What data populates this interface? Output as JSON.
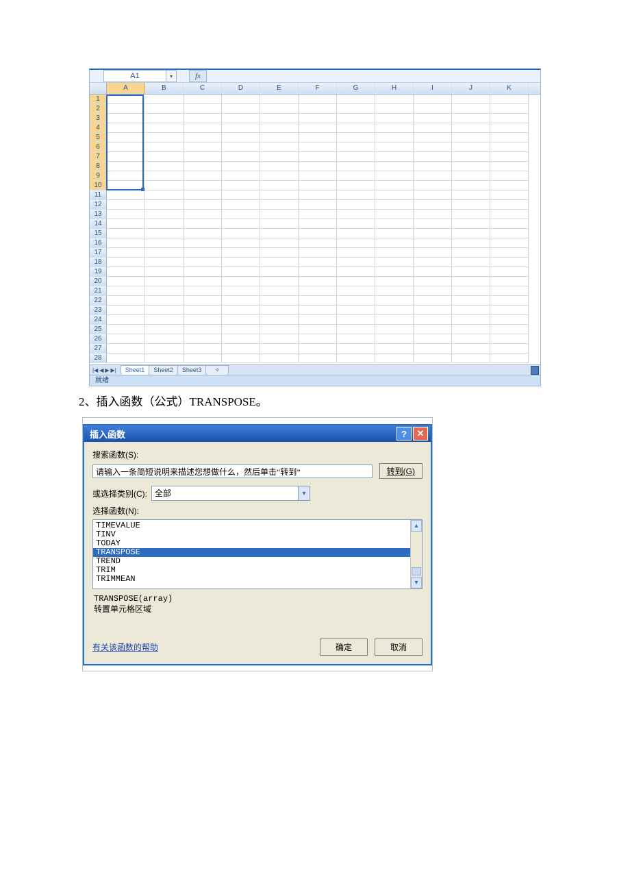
{
  "excel": {
    "namebox": "A1",
    "fx_label": "fx",
    "columns": [
      "A",
      "B",
      "C",
      "D",
      "E",
      "F",
      "G",
      "H",
      "I",
      "J",
      "K"
    ],
    "row_count": 28,
    "selected_col_index": 0,
    "selected_rows_end": 10,
    "sheet_nav": [
      "|◀",
      "◀",
      "▶",
      "▶|"
    ],
    "tabs": [
      "Sheet1",
      "Sheet2",
      "Sheet3"
    ],
    "active_tab_index": 0,
    "status": "就绪"
  },
  "instruction": "2、插入函数（公式）TRANSPOSE。",
  "dialog": {
    "title": "插入函数",
    "help_icon": "?",
    "close_icon": "✕",
    "search_label": "搜索函数(S):",
    "search_value": "请输入一条简短说明来描述您想做什么，然后单击“转到”",
    "go_label": "转到(G)",
    "category_label": "或选择类别(C):",
    "category_value": "全部",
    "select_label": "选择函数(N):",
    "functions": [
      "TIMEVALUE",
      "TINV",
      "TODAY",
      "TRANSPOSE",
      "TREND",
      "TRIM",
      "TRIMMEAN"
    ],
    "selected_index": 3,
    "desc_signature": "TRANSPOSE(array)",
    "desc_text": "转置单元格区域",
    "help_link": "有关该函数的帮助",
    "ok": "确定",
    "cancel": "取消"
  }
}
